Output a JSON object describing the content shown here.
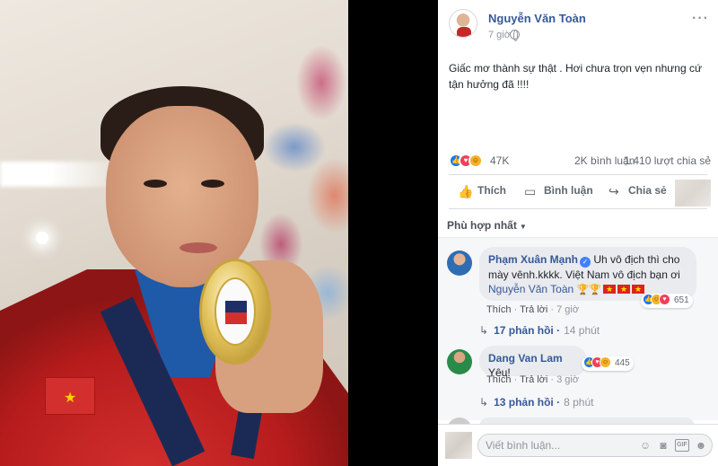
{
  "post": {
    "author": "Nguyễn Văn Toàn",
    "time": "7 giờ",
    "text": "Giấc mơ thành sự thật . Hơi chưa trọn vẹn nhưng cứ tận hưởng đã !!!!",
    "reaction_count": "47K",
    "comment_count": "2K bình luận",
    "share_count": "1.410 lượt chia sẻ",
    "reaction_types": [
      "like",
      "love",
      "haha"
    ]
  },
  "actions": {
    "like": "Thích",
    "comment": "Bình luận",
    "share": "Chia sẻ"
  },
  "sort": {
    "label": "Phù hợp nhất"
  },
  "comments": [
    {
      "name": "Phạm Xuân Mạnh",
      "verified": true,
      "text": "Uh vô địch thì cho mày vênh.kkkk. Việt Nam vô địch bạn ơi",
      "tag": "Nguyễn Văn Toàn",
      "reaction_count": "651",
      "like_label": "Thích",
      "reply_label": "Trả lời",
      "time": "7 giờ",
      "replies": "17 phản hồi",
      "replies_time": "14 phút"
    },
    {
      "name": "Dang Van Lam",
      "verified": false,
      "text": "Yêu!",
      "reaction_count": "445",
      "like_label": "Thích",
      "reply_label": "Trả lời",
      "time": "3 giờ",
      "replies": "13 phản hồi",
      "replies_time": "8 phút"
    }
  ],
  "composer": {
    "placeholder": "Viết bình luận...",
    "icons": [
      "emoji-icon",
      "camera-icon",
      "gif-icon",
      "sticker-icon"
    ]
  },
  "colors": {
    "link": "#365899",
    "like_blue": "#1877f2",
    "love_red": "#f33e58",
    "haha_yellow": "#f7b125"
  }
}
